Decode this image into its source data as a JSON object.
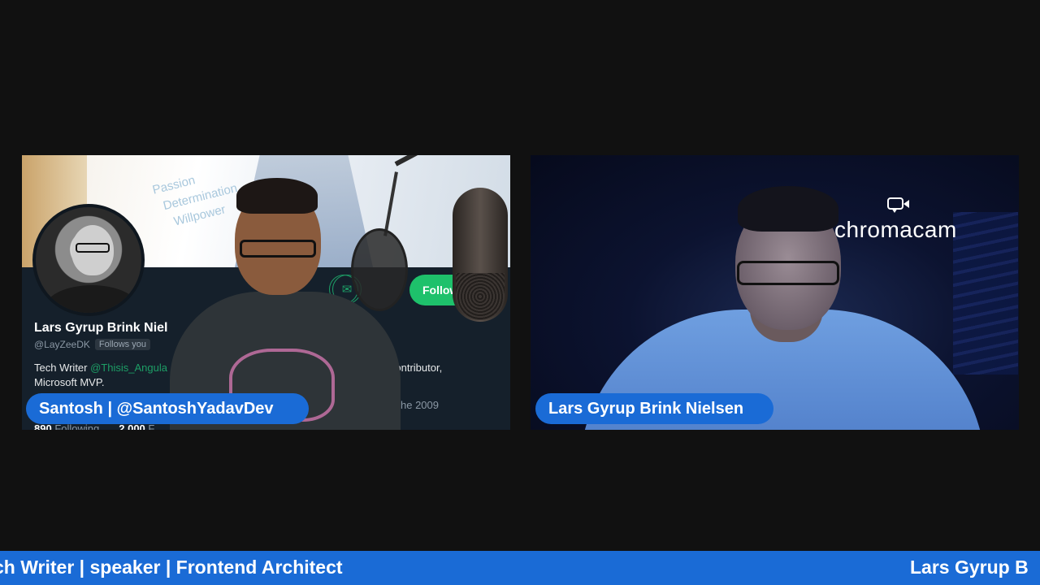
{
  "left_tile": {
    "profile": {
      "name": "Lars Gyrup Brink Niel",
      "handle": "@LayZeeDK",
      "follows_badge": "Follows you",
      "bio_prefix": "Tech Writer ",
      "bio_link": "@Thisis_Angula",
      "bio_right": "Contributor,",
      "bio_line2": "Microsoft MVP.",
      "joined_partial": "he 2009",
      "following_count": "890",
      "following_label": "Following",
      "followers_count": "2,000",
      "followers_label": "F",
      "follow_button_label": "Follow",
      "slide_words": [
        "Passion",
        "Determination",
        "Willpower"
      ],
      "message_icon_glyph": "✉"
    },
    "name_tag": "Santosh | @SantoshYadavDev"
  },
  "right_tile": {
    "logo_text": "chromacam",
    "name_tag": "Lars Gyrup Brink Nielsen"
  },
  "ticker": {
    "segment_a": "ch Writer | speaker | Frontend Architect",
    "segment_b": "Lars Gyrup B"
  },
  "colors": {
    "background": "#111111",
    "accent_blue": "#1a6bd6",
    "follow_green": "#1ec16b"
  }
}
